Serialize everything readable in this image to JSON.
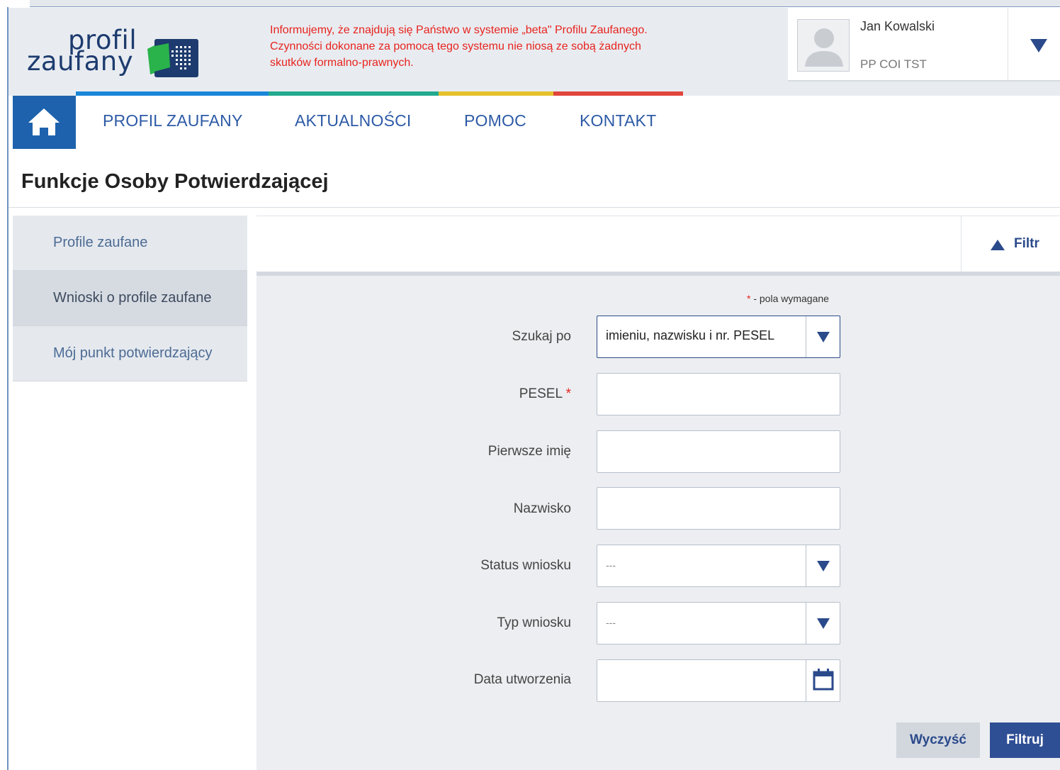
{
  "logo": {
    "line1": "profil",
    "line2": "zaufany"
  },
  "beta_notice": {
    "line1": "Informujemy, że znajdują się Państwo w systemie „beta\" Profilu Zaufanego.",
    "line2": "Czynności dokonane za pomocą tego systemu nie niosą ze sobą żadnych",
    "line3": "skutków formalno-prawnych."
  },
  "user": {
    "name": "Jan Kowalski",
    "role": "PP COI TST"
  },
  "nav": {
    "items": [
      "PROFIL ZAUFANY",
      "AKTUALNOŚCI",
      "POMOC",
      "KONTAKT"
    ],
    "stripe_colors": [
      "#1a86d8",
      "#22a98f",
      "#e5c12b",
      "#e0463c"
    ]
  },
  "page_title": "Funkcje Osoby Potwierdzającej",
  "sidebar": {
    "items": [
      {
        "label": "Profile zaufane",
        "active": false
      },
      {
        "label": "Wnioski o profile zaufane",
        "active": true
      },
      {
        "label": "Mój punkt potwierdzający",
        "active": false
      }
    ]
  },
  "filter": {
    "toggle_label": "Filtr",
    "required_note_star": "*",
    "required_note": " - pola wymagane",
    "fields": {
      "search_by": {
        "label": "Szukaj po",
        "value": "imieniu, nazwisku i nr. PESEL"
      },
      "pesel": {
        "label": "PESEL",
        "required": "*",
        "value": ""
      },
      "first_name": {
        "label": "Pierwsze imię",
        "value": ""
      },
      "last_name": {
        "label": "Nazwisko",
        "value": ""
      },
      "status": {
        "label": "Status wniosku",
        "value": "---"
      },
      "type": {
        "label": "Typ wniosku",
        "value": "---"
      },
      "created": {
        "label": "Data utworzenia",
        "value": ""
      }
    },
    "buttons": {
      "clear": "Wyczyść",
      "submit": "Filtruj"
    }
  },
  "colors": {
    "brand": "#1e62ad",
    "accent": "#2b4a8b",
    "warning": "#e8231d"
  }
}
